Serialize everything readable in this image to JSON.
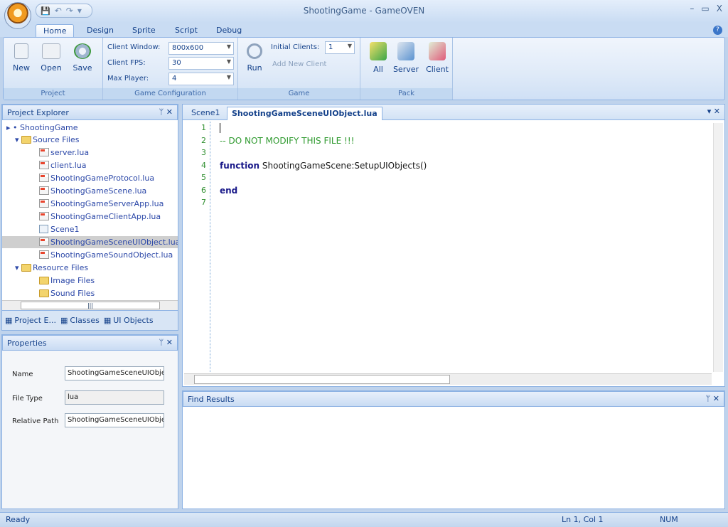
{
  "window": {
    "title": "ShootingGame - GameOVEN",
    "minimize": "–",
    "maximize": "▭",
    "close": "X"
  },
  "qat": {
    "save": "💾",
    "undo": "↶",
    "redo": "↷",
    "more": "▾"
  },
  "ribbon_tabs": [
    "Home",
    "Design",
    "Sprite",
    "Script",
    "Debug"
  ],
  "ribbon": {
    "project": {
      "label": "Project",
      "new": "New",
      "open": "Open",
      "save": "Save"
    },
    "config": {
      "label": "Game Configuration",
      "client_window_label": "Client Window:",
      "client_window_value": "800x600",
      "client_fps_label": "Client FPS:",
      "client_fps_value": "30",
      "max_player_label": "Max Player:",
      "max_player_value": "4"
    },
    "game": {
      "label": "Game",
      "run": "Run",
      "initial_clients_label": "Initial Clients:",
      "initial_clients_value": "1",
      "add_new_client": "Add New Client"
    },
    "pack": {
      "label": "Pack",
      "all": "All",
      "server": "Server",
      "client": "Client"
    }
  },
  "explorer": {
    "title": "Project Explorer",
    "pin": "ᛘ ✕",
    "root": "ShootingGame",
    "source_folder": "Source Files",
    "files": [
      "server.lua",
      "client.lua",
      "ShootingGameProtocol.lua",
      "ShootingGameScene.lua",
      "ShootingGameServerApp.lua",
      "ShootingGameClientApp.lua",
      "Scene1",
      "ShootingGameSceneUIObject.lua",
      "ShootingGameSoundObject.lua"
    ],
    "resource_folder": "Resource Files",
    "image_folder": "Image Files",
    "sound_folder": "Sound Files",
    "tabs": [
      "Project E...",
      "Classes",
      "UI Objects"
    ]
  },
  "properties": {
    "title": "Properties",
    "pin": "ᛘ ✕",
    "rows": [
      {
        "label": "Name",
        "value": "ShootingGameSceneUIObje"
      },
      {
        "label": "File Type",
        "value": "lua"
      },
      {
        "label": "Relative Path",
        "value": "ShootingGameSceneUIObje"
      }
    ]
  },
  "editor": {
    "tabs": [
      "Scene1",
      "ShootingGameSceneUIObject.lua"
    ],
    "tab_close": "▾ ✕",
    "line_numbers": [
      "1",
      "2",
      "3",
      "4",
      "5",
      "6",
      "7"
    ],
    "comment": "-- DO NOT MODIFY THIS FILE !!!",
    "kw_function": "function",
    "func_name": " ShootingGameScene:SetupUIObjects()",
    "kw_end": "end"
  },
  "find": {
    "title": "Find Results",
    "pin": "ᛘ ✕"
  },
  "status": {
    "left": "Ready",
    "position": "Ln 1, Col 1",
    "num": "NUM"
  }
}
